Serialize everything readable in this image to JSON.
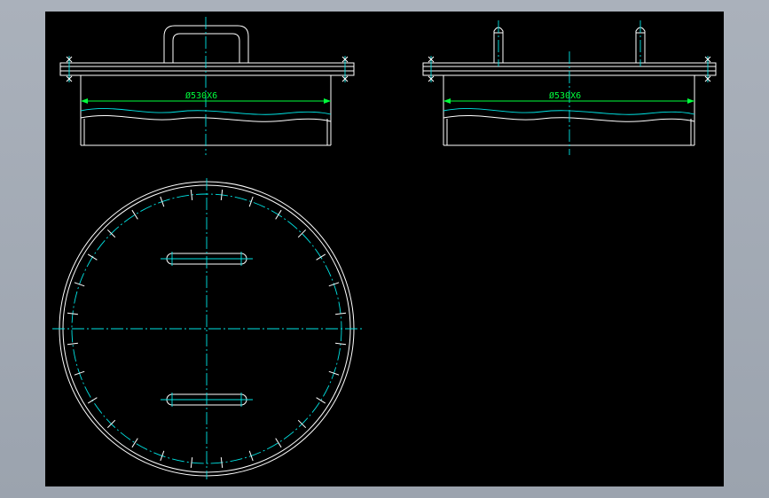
{
  "drawing": {
    "background": "#000000",
    "frame_color": "#9ba3ae",
    "line_color": "#ffffff",
    "centerline_color": "#00e5e5",
    "dimension_color": "#00ff3c",
    "front_view": {
      "dimension_label": "Ø530X6",
      "handle_count": 1
    },
    "side_view": {
      "dimension_label": "Ø530X6",
      "handle_count": 2
    },
    "plan_view": {
      "handle_count": 2,
      "bolt_mark_count": 28
    }
  }
}
